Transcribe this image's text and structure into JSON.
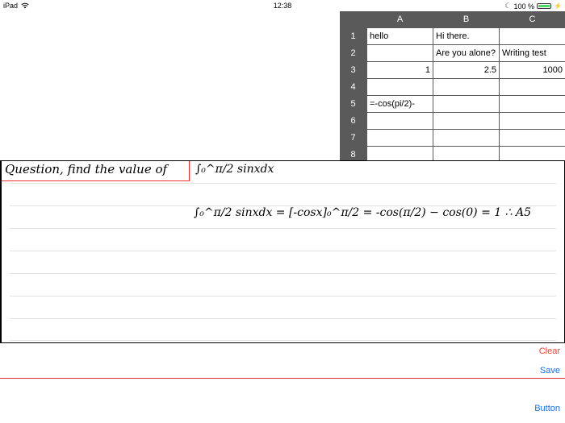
{
  "status_bar": {
    "device": "iPad",
    "time": "12:38",
    "battery": "100 %",
    "battery_level": 1.0
  },
  "spreadsheet": {
    "columns": [
      "A",
      "B",
      "C"
    ],
    "rows": [
      "1",
      "2",
      "3",
      "4",
      "5",
      "6",
      "7",
      "8"
    ],
    "cells": [
      [
        "hello",
        "Hi there.",
        ""
      ],
      [
        "",
        "Are you alone?",
        "Writing test"
      ],
      [
        "1",
        "2.5",
        "1000"
      ],
      [
        "",
        "",
        ""
      ],
      [
        "=-cos(pi/2)-",
        "",
        ""
      ],
      [
        "",
        "",
        ""
      ],
      [
        "",
        "",
        ""
      ],
      [
        "",
        "",
        ""
      ]
    ]
  },
  "writing_pad": {
    "question": "Question, find the value of",
    "integral_prompt": "∫₀^π/2 sinxdx",
    "work": "∫₀^π/2 sinxdx = [-cosx]₀^π/2 = -cos(π/2) − cos(0) = 1 ∴ A5"
  },
  "buttons": {
    "clear": "Clear",
    "save": "Save",
    "button": "Button"
  },
  "colors": {
    "header_bg": "#5a5a5a",
    "clear": "#ff3b30",
    "link": "#1a73e8",
    "divider": "#e03030"
  }
}
